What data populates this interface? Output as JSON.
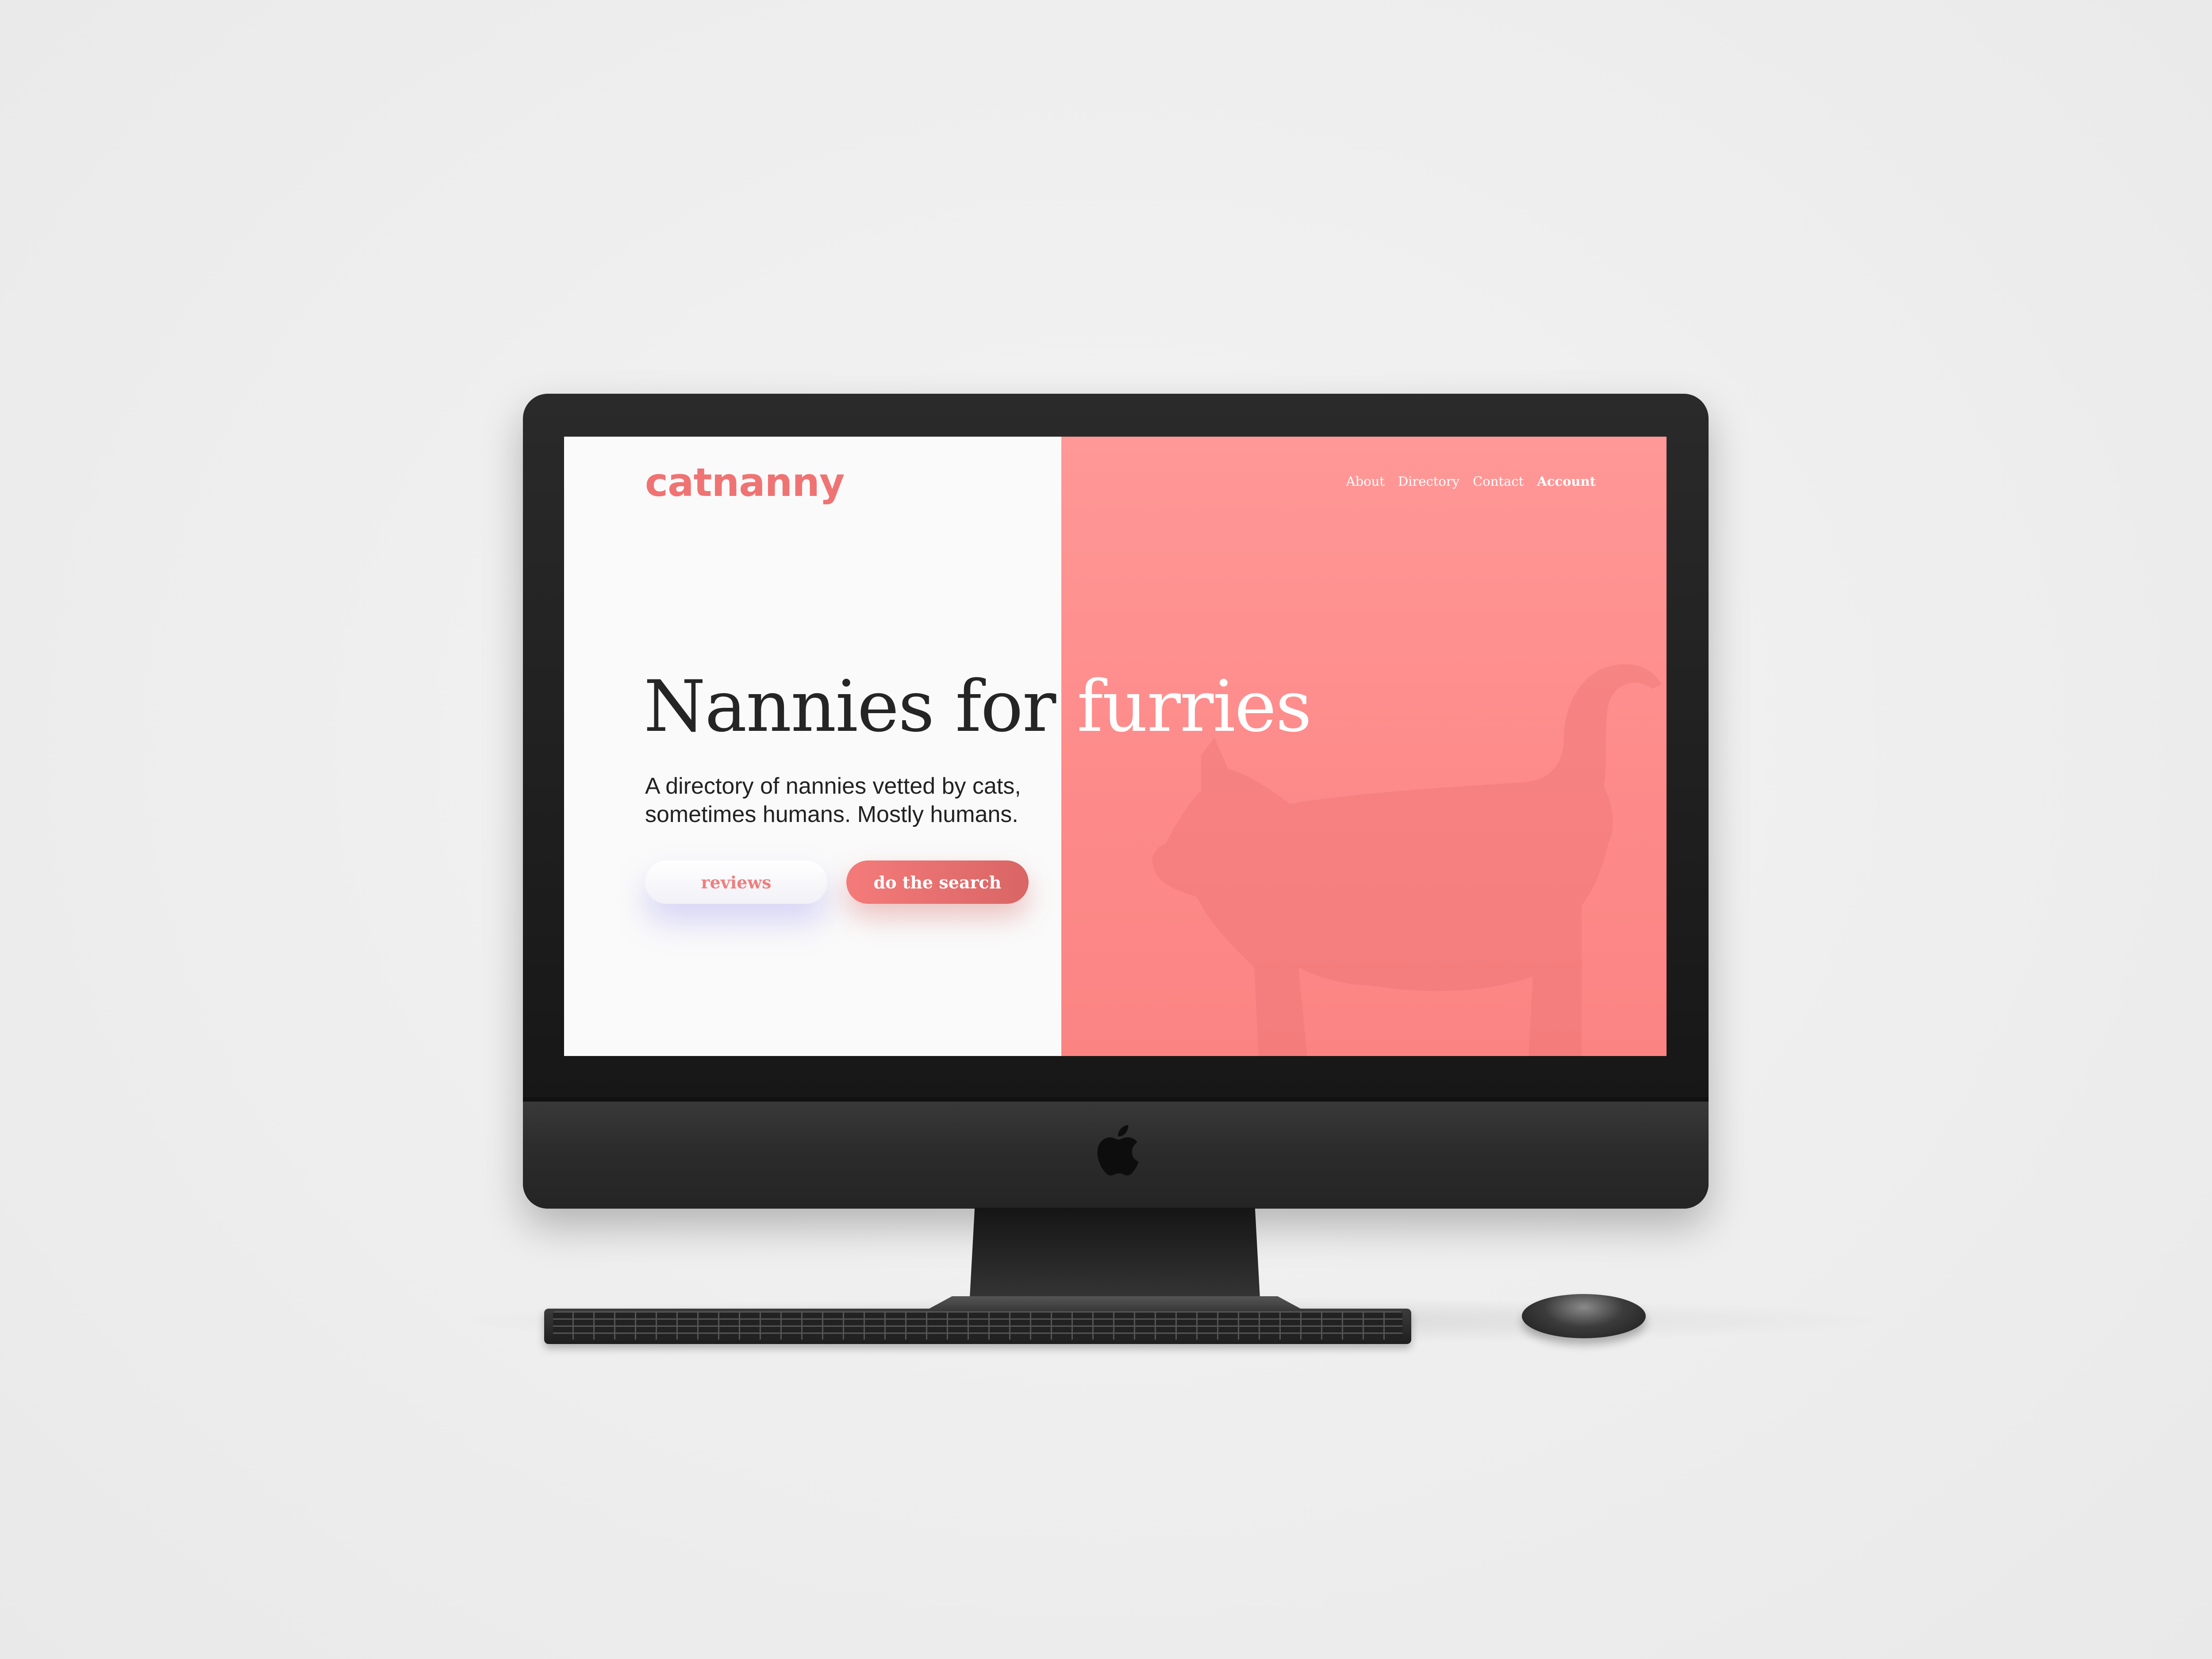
{
  "site": {
    "logo": "catnanny",
    "nav": [
      "About",
      "Directory",
      "Contact",
      "Account"
    ],
    "headline_part1": "Nannies for ",
    "headline_part2": "furries",
    "subtitle_line1": "A directory of nannies vetted by cats,",
    "subtitle_line2": "sometimes humans. Mostly humans.",
    "buttons": {
      "reviews": "reviews",
      "search": "do the search"
    }
  },
  "colors": {
    "brand_coral": "#f07373",
    "panel_pink": "#fd8b8a",
    "text_dark": "#252525",
    "background": "#fafafa"
  },
  "icons": [
    "apple-logo-icon",
    "cat-silhouette"
  ]
}
